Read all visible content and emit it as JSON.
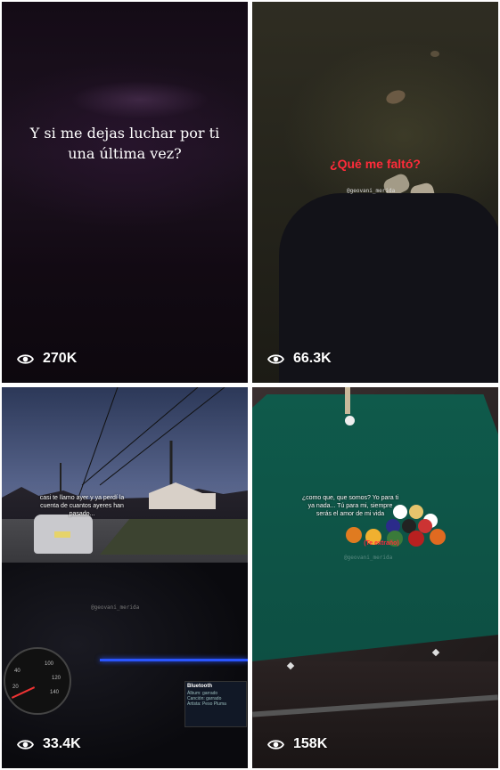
{
  "grid": {
    "videos": [
      {
        "caption": "Y si me dejas luchar por ti una última vez?",
        "views": "270K"
      },
      {
        "caption": "¿Qué me faltó?",
        "handle": "@geovani_merida",
        "views": "66.3K"
      },
      {
        "caption": "casi te llamo ayer y ya perdí la cuenta de cuantos ayeres han pasado...",
        "handle": "@geovani_merida",
        "views": "33.4K"
      },
      {
        "caption": "¿como que, que somos? Yo para ti ya nada... Tú para mi, siempre serás el amor de mi vida",
        "subcaption": "(Te extraño)",
        "handle": "@geovani_merida",
        "views": "158K"
      }
    ]
  },
  "dashboard": {
    "screen_title": "Bluetooth",
    "fields": [
      "Álbum: garrado",
      "Canción: garrado",
      "Artista: Peso Pluma"
    ],
    "gauge_labels": [
      "100",
      "120",
      "140",
      "40",
      "20"
    ]
  },
  "colors": {
    "caption_red": "#ff2b3a",
    "caption_white": "#ffffff",
    "felt": "#0f5a4b"
  }
}
